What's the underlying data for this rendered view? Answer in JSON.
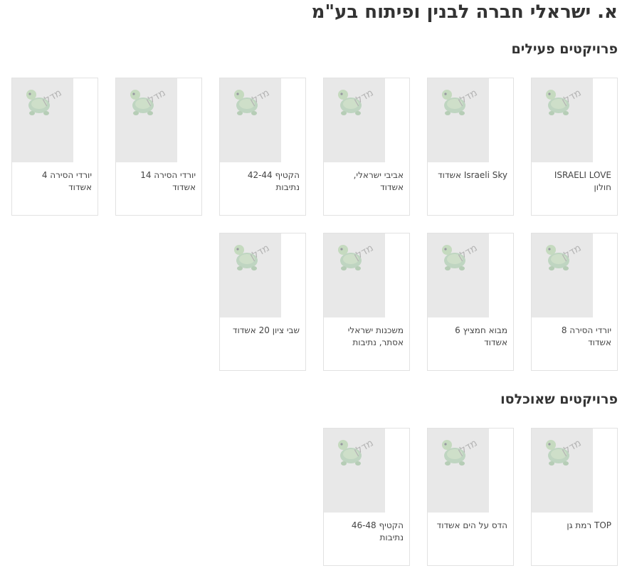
{
  "company": {
    "title": "א. ישראלי חברה לבנין ופיתוח בע\"מ"
  },
  "sections": [
    {
      "title": "פרויקטים פעילים",
      "projects": [
        "ISRAELI LOVE חולון",
        "Israeli Sky אשדוד",
        "אביבי ישראלי, אשדוד",
        "הקטיף 42-44 נתיבות",
        "יורדי הסירה 14 אשדוד",
        "יורדי הסירה 4 אשדוד",
        "יורדי הסירה 8 אשדוד",
        "מבוא חמציץ 6 אשדוד",
        "משכנות ישראלי אסתר, נתיבות",
        "שבי ציון 20 אשדוד"
      ]
    },
    {
      "title": "פרויקטים שאוכלסו",
      "projects": [
        "TOP רמת גן",
        "הדס על הים אשדוד",
        "הקטיף 46-48 נתיבות"
      ]
    }
  ],
  "placeholder_logo": {
    "text": "מדלן",
    "icon": "turtle-logo-icon"
  }
}
